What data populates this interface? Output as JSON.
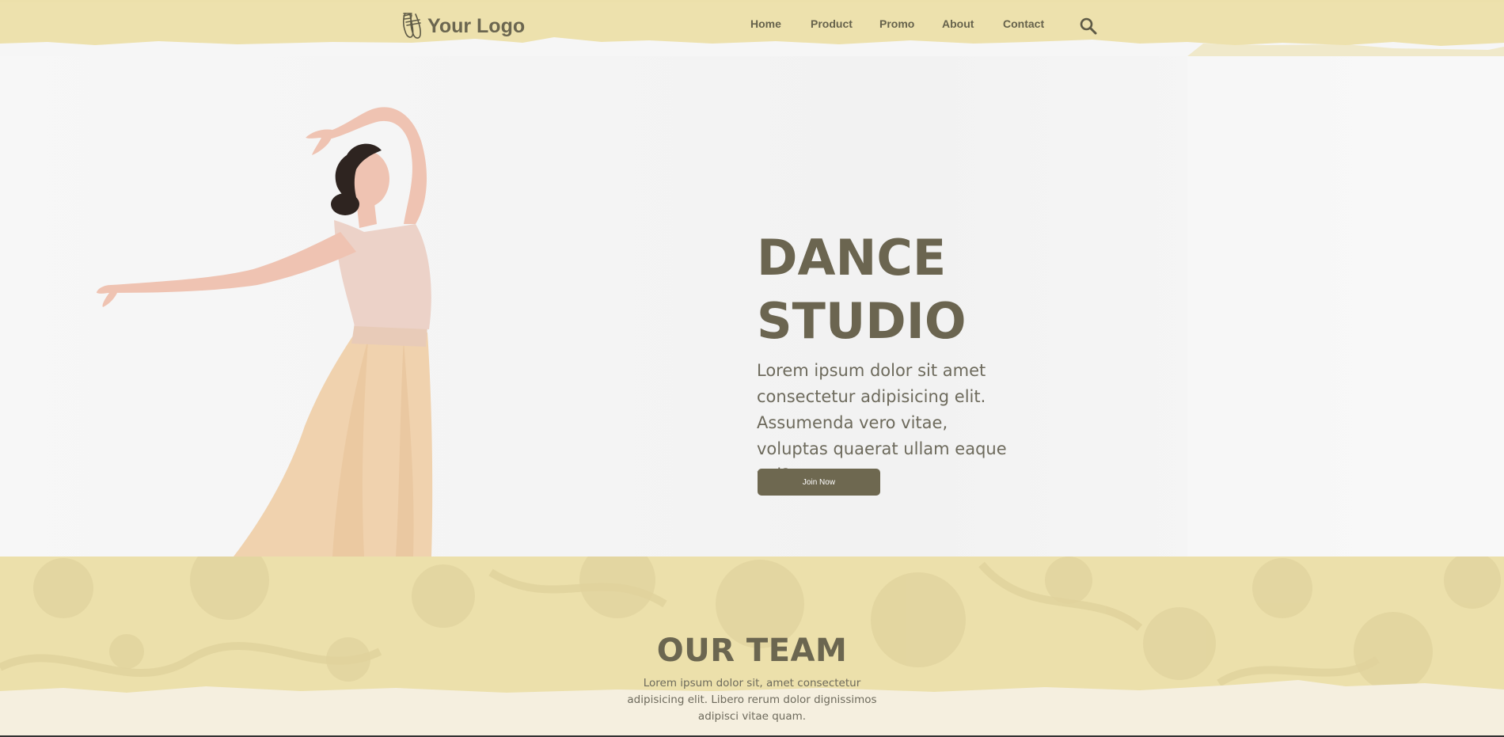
{
  "header": {
    "logo_text": "Your Logo",
    "nav": [
      {
        "label": "Home"
      },
      {
        "label": "Product"
      },
      {
        "label": "Promo"
      },
      {
        "label": "About"
      },
      {
        "label": "Contact"
      }
    ],
    "search_icon": "search-icon"
  },
  "hero": {
    "title_line1": "DANCE",
    "title_line2": "STUDIO",
    "text": "Lorem ipsum dolor sit amet consectetur adipisicing elit. Assumenda vero vitae, voluptas quaerat ullam eaque vel?",
    "button_label": "Join Now"
  },
  "team": {
    "title": "OUR TEAM",
    "text": "Lorem ipsum dolor sit, amet consectetur adipisicing elit. Libero rerum dolor dignissimos adipisci vitae quam."
  },
  "colors": {
    "header_bg": "#ede1ad",
    "brand_text": "#6b6650",
    "button_bg": "#6e6850",
    "hero_bg": "#f5f5f5"
  }
}
